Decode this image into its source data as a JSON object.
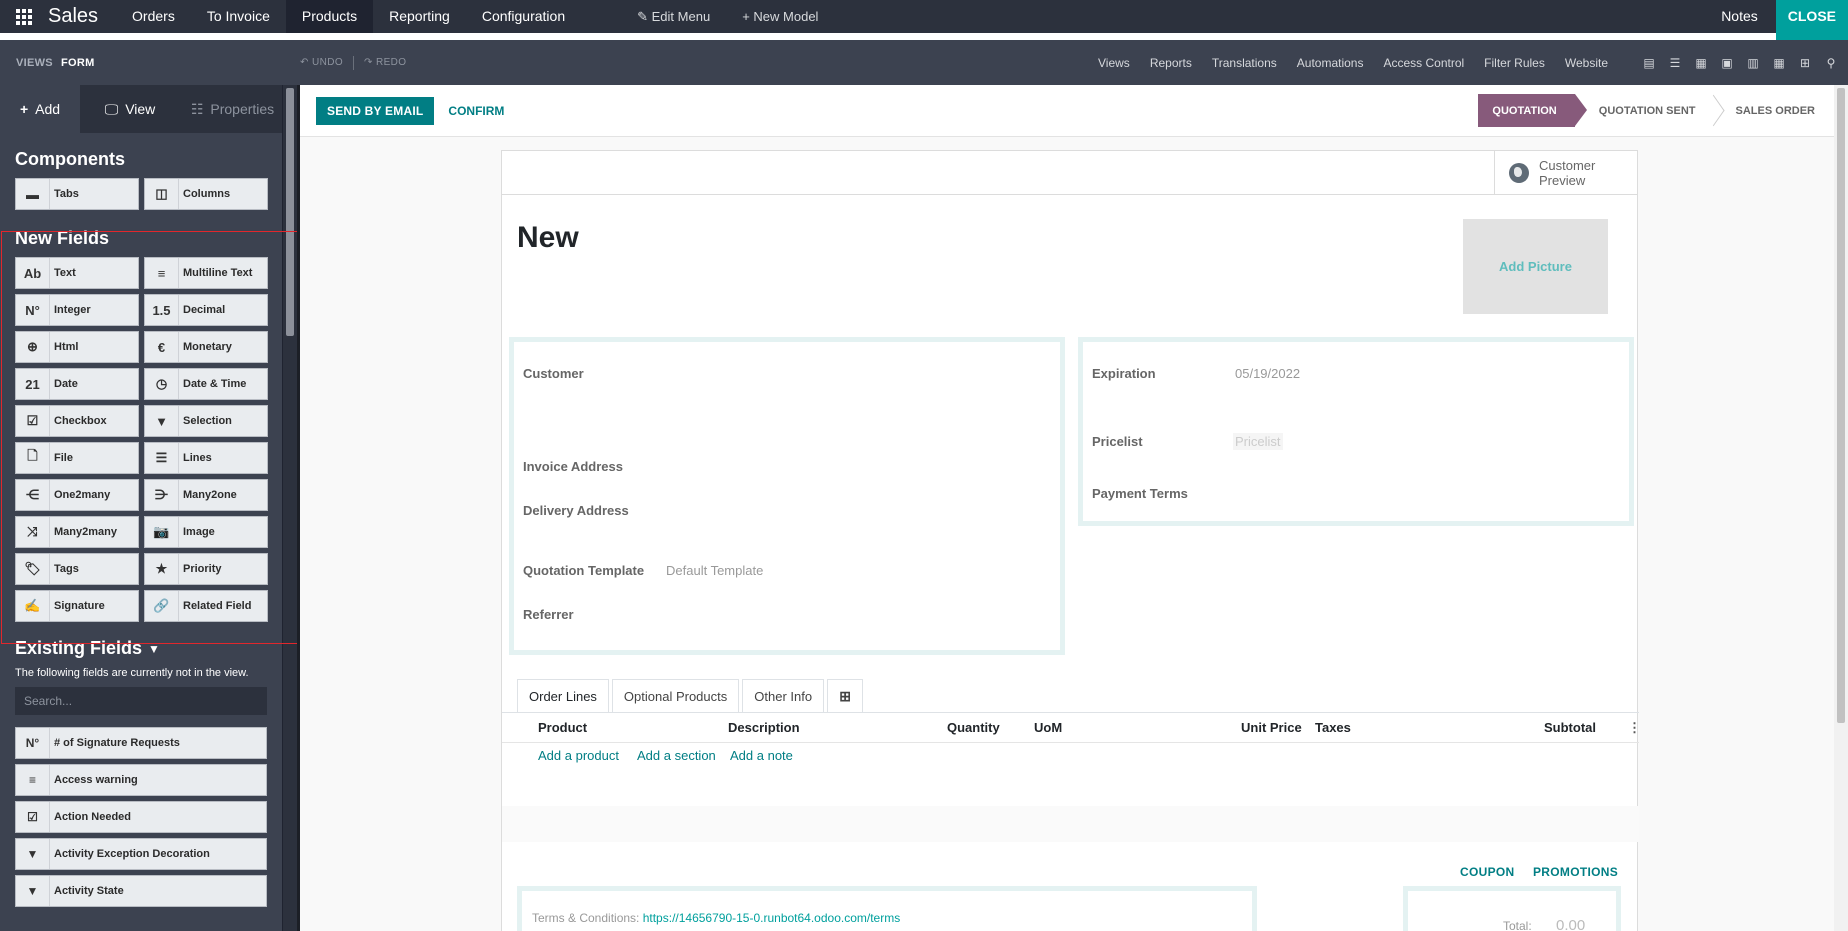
{
  "navbar": {
    "app_name": "Sales",
    "menus": [
      "Orders",
      "To Invoice",
      "Products",
      "Reporting",
      "Configuration"
    ],
    "studio_items": [
      "Edit Menu",
      "New Model"
    ],
    "notes": "Notes",
    "close": "CLOSE"
  },
  "subbar": {
    "crumb_views": "VIEWS",
    "crumb_form": "FORM",
    "undo": "UNDO",
    "redo": "REDO",
    "links": [
      "Views",
      "Reports",
      "Translations",
      "Automations",
      "Access Control",
      "Filter Rules",
      "Website"
    ],
    "view_icons": [
      "form-view-icon",
      "list-view-icon",
      "kanban-view-icon",
      "calendar-view-icon",
      "graph-view-icon",
      "pivot-view-icon",
      "grid-view-icon",
      "search-view-icon"
    ]
  },
  "sidebar": {
    "tabs": {
      "add": "Add",
      "view": "View",
      "properties": "Properties"
    },
    "components_title": "Components",
    "components": [
      {
        "label": "Tabs",
        "icon": "tabs-icon"
      },
      {
        "label": "Columns",
        "icon": "columns-icon"
      }
    ],
    "new_fields_title": "New Fields",
    "new_fields": [
      {
        "label": "Text",
        "glyph": "Ab"
      },
      {
        "label": "Multiline Text",
        "glyph": "≡"
      },
      {
        "label": "Integer",
        "glyph": "N°"
      },
      {
        "label": "Decimal",
        "glyph": "1.5"
      },
      {
        "label": "Html",
        "glyph": "⊕"
      },
      {
        "label": "Monetary",
        "glyph": "€"
      },
      {
        "label": "Date",
        "glyph": "21"
      },
      {
        "label": "Date & Time",
        "glyph": "◷"
      },
      {
        "label": "Checkbox",
        "glyph": "☑"
      },
      {
        "label": "Selection",
        "glyph": "▼"
      },
      {
        "label": "File",
        "glyph": "🗋"
      },
      {
        "label": "Lines",
        "glyph": "☰"
      },
      {
        "label": "One2many",
        "glyph": "⋲"
      },
      {
        "label": "Many2one",
        "glyph": "⋺"
      },
      {
        "label": "Many2many",
        "glyph": "⤨"
      },
      {
        "label": "Image",
        "glyph": "📷"
      },
      {
        "label": "Tags",
        "glyph": "🏷"
      },
      {
        "label": "Priority",
        "glyph": "★"
      },
      {
        "label": "Signature",
        "glyph": "✍"
      },
      {
        "label": "Related Field",
        "glyph": "🔗"
      }
    ],
    "existing_title": "Existing Fields",
    "existing_note": "The following fields are currently not in the view.",
    "existing_search_placeholder": "Search...",
    "existing_fields": [
      {
        "label": "# of Signature Requests",
        "glyph": "N°"
      },
      {
        "label": "Access warning",
        "glyph": "≡"
      },
      {
        "label": "Action Needed",
        "glyph": "☑"
      },
      {
        "label": "Activity Exception Decoration",
        "glyph": "▼"
      },
      {
        "label": "Activity State",
        "glyph": "▼"
      }
    ]
  },
  "form": {
    "send_by_email": "SEND BY EMAIL",
    "confirm": "CONFIRM",
    "stages": [
      "QUOTATION",
      "QUOTATION SENT",
      "SALES ORDER"
    ],
    "customer_preview_line1": "Customer",
    "customer_preview_line2": "Preview",
    "title": "New",
    "add_picture": "Add Picture",
    "left_fields": {
      "customer": "Customer",
      "invoice_address": "Invoice Address",
      "delivery_address": "Delivery Address",
      "quotation_template": "Quotation Template",
      "quotation_template_value": "Default Template",
      "referrer": "Referrer"
    },
    "right_fields": {
      "expiration": "Expiration",
      "expiration_value": "05/19/2022",
      "pricelist": "Pricelist",
      "pricelist_placeholder": "Pricelist",
      "payment_terms": "Payment Terms"
    },
    "tabs": [
      "Order Lines",
      "Optional Products",
      "Other Info"
    ],
    "columns": [
      "Product",
      "Description",
      "Quantity",
      "UoM",
      "Unit Price",
      "Taxes",
      "Subtotal"
    ],
    "add_links": [
      "Add a product",
      "Add a section",
      "Add a note"
    ],
    "coupon": "COUPON",
    "promotions": "PROMOTIONS",
    "terms_label": "Terms & Conditions:",
    "terms_link": "https://14656790-15-0.runbot64.odoo.com/terms",
    "total_label": "Total:",
    "total_value": "0.00"
  },
  "colors": {
    "navbar": "#2c313d",
    "accent_teal": "#017e84",
    "stage_active": "#875a7b",
    "highlight_box": "#e2272c"
  }
}
